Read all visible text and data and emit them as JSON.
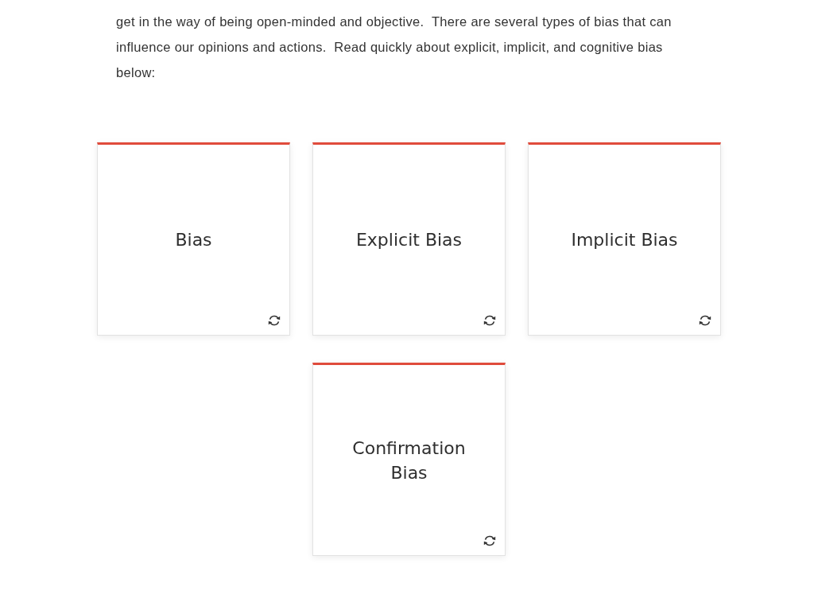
{
  "intro": {
    "text": "get in the way of being open-minded and objective.  There are several types of bias that can influence our opinions and actions.  Read quickly about explicit, implicit, and cognitive bias below:"
  },
  "cards": [
    {
      "title": "Bias"
    },
    {
      "title": "Explicit Bias"
    },
    {
      "title": "Implicit Bias"
    },
    {
      "title": "Confirmation Bias"
    }
  ]
}
